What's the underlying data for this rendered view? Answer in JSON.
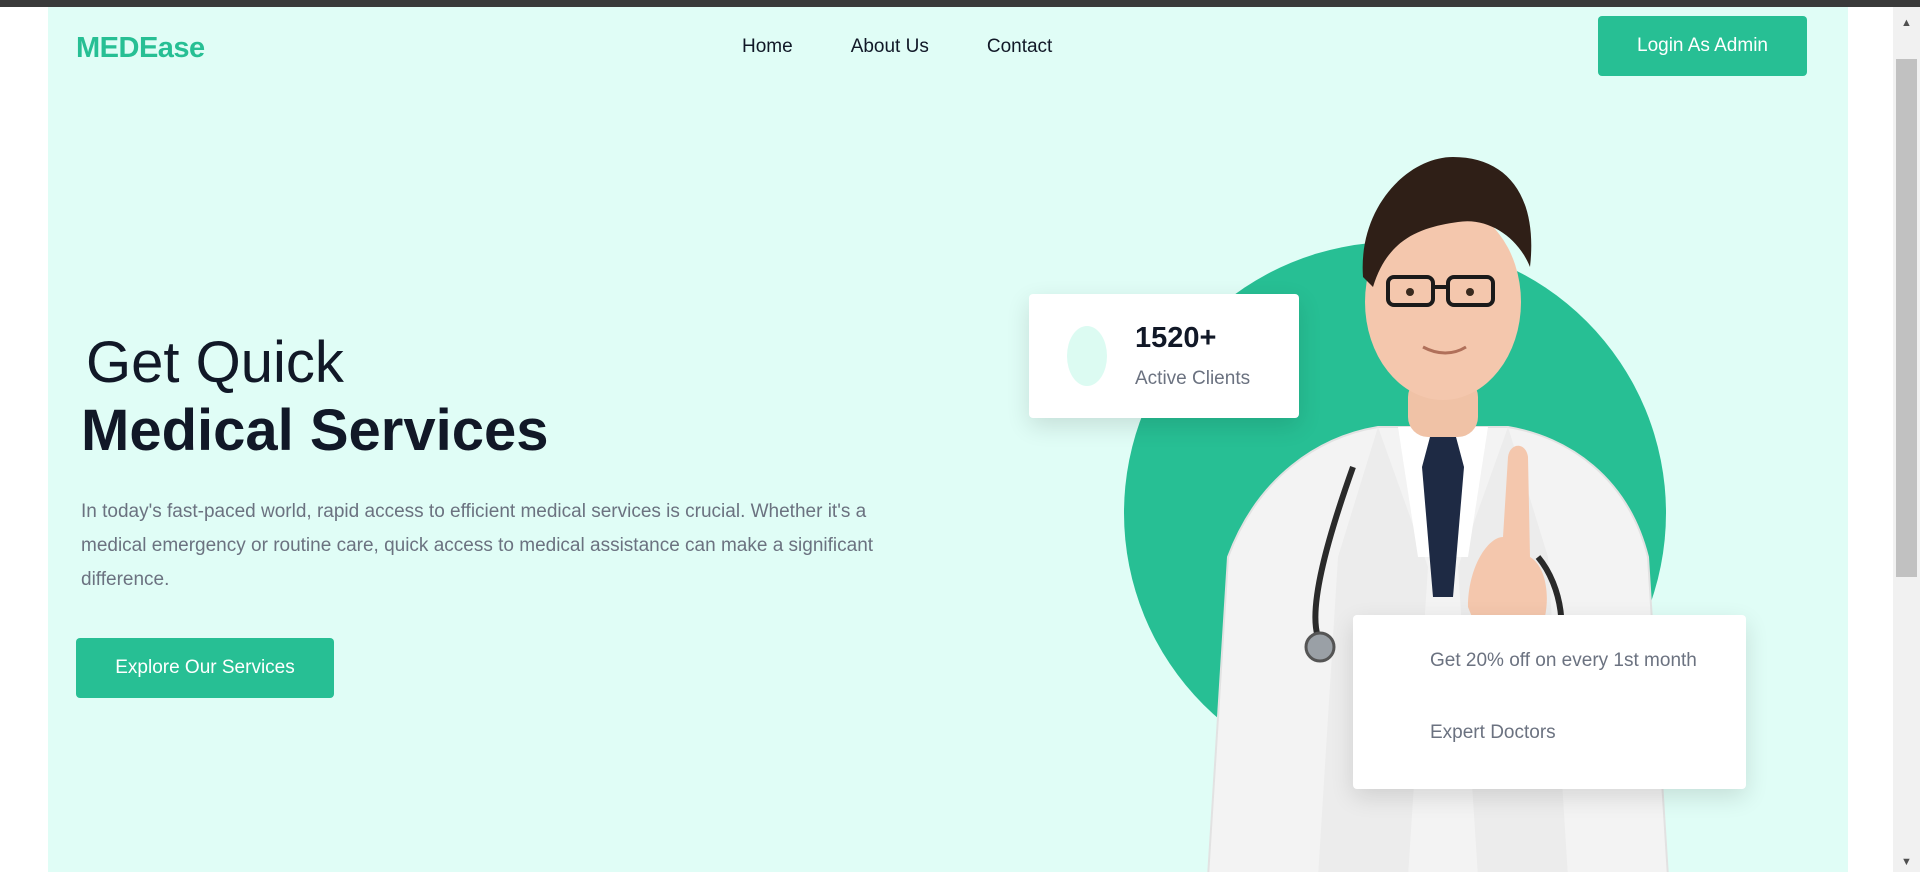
{
  "header": {
    "logo": "MEDEase",
    "nav": [
      {
        "label": "Home"
      },
      {
        "label": "About Us"
      },
      {
        "label": "Contact"
      }
    ],
    "admin_button": "Login As Admin"
  },
  "hero": {
    "line1": "Get Quick",
    "line2": "Medical Services",
    "description": "In today's fast-paced world, rapid access to efficient medical services is crucial. Whether it's a medical emergency or routine care, quick access to medical assistance can make a significant difference.",
    "cta_button": "Explore Our Services"
  },
  "stats_card": {
    "value": "1520+",
    "label": "Active Clients"
  },
  "offers_card": {
    "items": [
      {
        "text": "Get 20% off on every 1st month"
      },
      {
        "text": "Expert Doctors"
      }
    ]
  },
  "colors": {
    "accent": "#27bf94",
    "background": "#e0fdf6",
    "text_dark": "#111827",
    "text_muted": "#6b7280"
  },
  "icons": {
    "scroll_up": "scroll-up-arrow-icon",
    "scroll_down": "scroll-down-arrow-icon",
    "doctor": "doctor-illustration"
  }
}
